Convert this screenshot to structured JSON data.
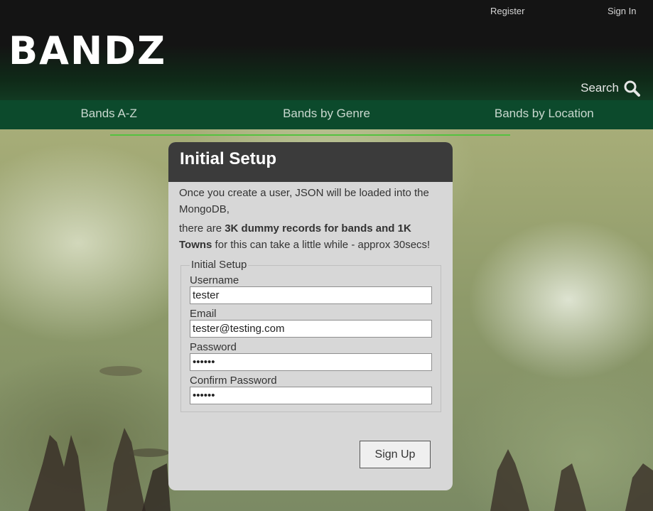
{
  "header": {
    "logo": "BANDZ",
    "register_label": "Register",
    "signin_label": "Sign In",
    "search_label": "Search",
    "search_icon": "magnifier"
  },
  "nav": {
    "items": [
      {
        "label": "Bands A-Z"
      },
      {
        "label": "Bands by Genre"
      },
      {
        "label": "Bands by Location"
      }
    ],
    "underline_color": "#55c240"
  },
  "setup": {
    "title": "Initial Setup",
    "intro": "Once you create a user, JSON will be loaded into the MongoDB,",
    "note_prefix": "there are ",
    "note_bold": "3K dummy records for bands and 1K Towns",
    "note_suffix": " for this can take a little while - approx 30secs!",
    "fieldset_legend": "Initial Setup",
    "fields": {
      "username": {
        "label": "Username",
        "value": "tester"
      },
      "email": {
        "label": "Email",
        "value": "tester@testing.com"
      },
      "password": {
        "label": "Password",
        "value": "••••••"
      },
      "confirm": {
        "label": "Confirm Password",
        "value": "••••••"
      }
    },
    "submit_label": "Sign Up"
  },
  "colors": {
    "header_bg": "#141414",
    "nav_bg": "#0c4a2c",
    "panel_head": "#3b3b3b",
    "panel_body": "#d7d7d7"
  }
}
